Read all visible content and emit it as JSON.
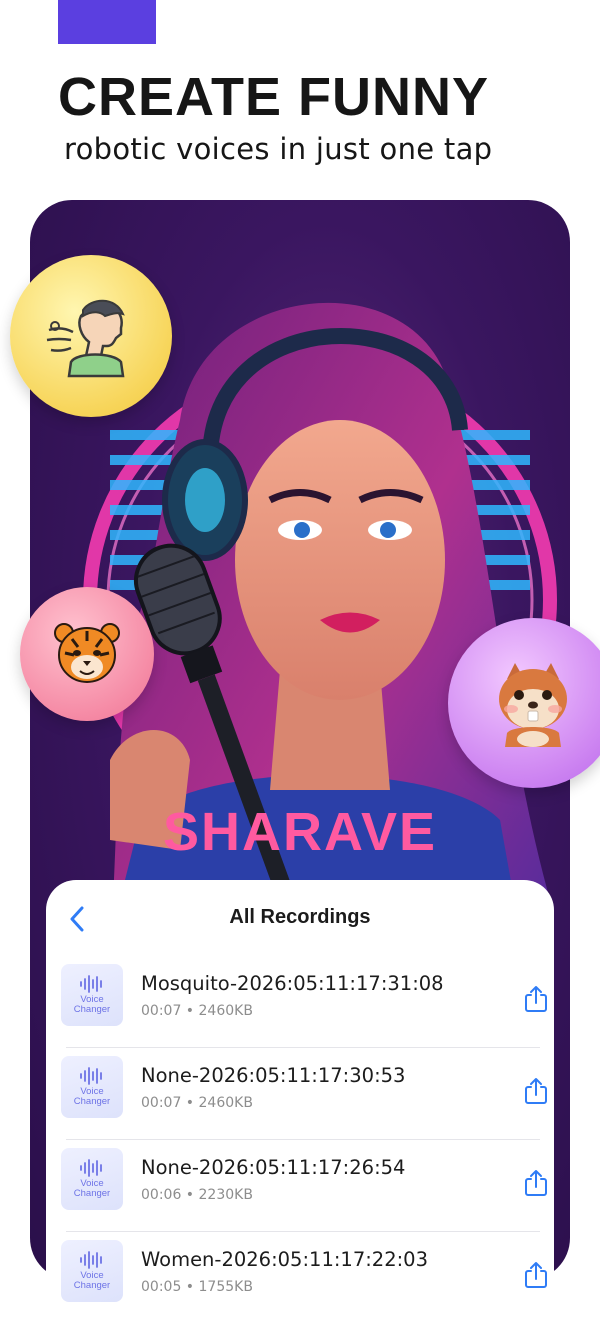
{
  "promo": {
    "headline": "CREATE FUNNY",
    "subline": "robotic voices in just one tap"
  },
  "hero": {
    "shirt_text": "SHARAVE"
  },
  "panel": {
    "title": "All Recordings",
    "thumb_label_line1": "Voice",
    "thumb_label_line2": "Changer",
    "recordings": [
      {
        "name": "Mosquito-2026:05:11:17:31:08",
        "meta": "00:07 • 2460KB"
      },
      {
        "name": "None-2026:05:11:17:30:53",
        "meta": "00:07 • 2460KB"
      },
      {
        "name": "None-2026:05:11:17:26:54",
        "meta": "00:06 • 2230KB"
      },
      {
        "name": "Women-2026:05:11:17:22:03",
        "meta": "00:05 • 1755KB"
      }
    ]
  },
  "icons": {
    "back": "chevron-left-icon",
    "share": "share-icon",
    "badge_1": "blowing-person-icon",
    "badge_2": "tiger-icon",
    "badge_3": "chipmunk-icon"
  },
  "colors": {
    "accent": "#5b3fe0",
    "ios_blue": "#2f7cf6",
    "thumb_text": "#6d73e6"
  }
}
